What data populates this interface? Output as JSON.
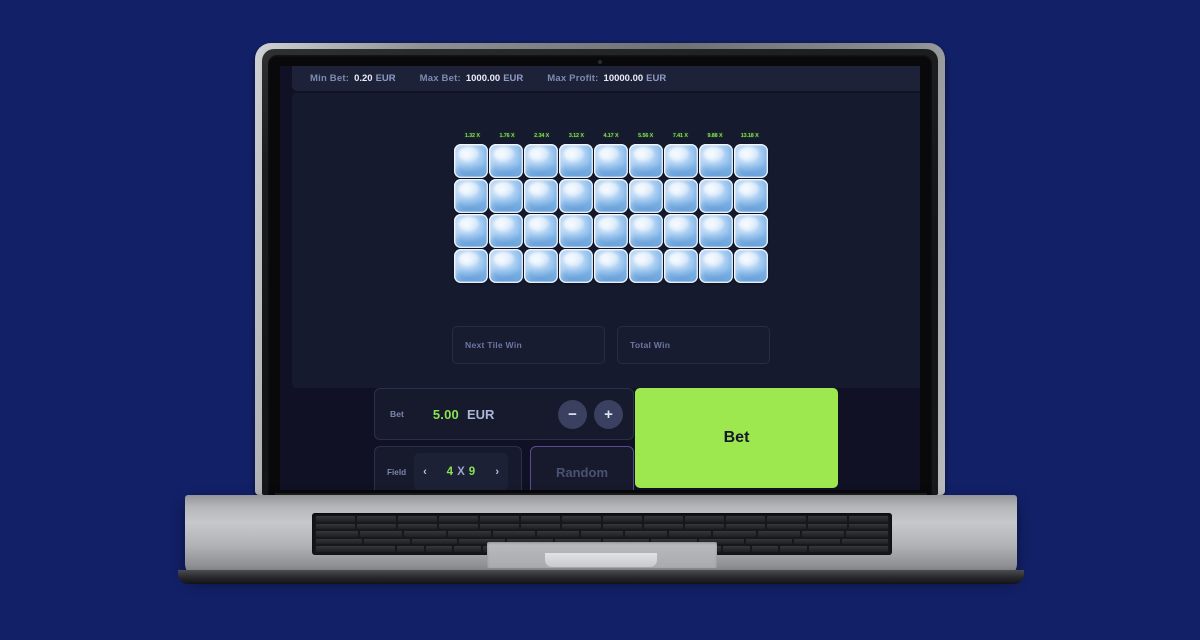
{
  "background_color": "#122068",
  "device": {
    "name": "laptop",
    "brand_accent": "#b7b9bb"
  },
  "topbar": {
    "items": [
      {
        "label": "Min Bet:",
        "value": "0.20",
        "currency": "EUR"
      },
      {
        "label": "Max Bet:",
        "value": "1000.00",
        "currency": "EUR"
      },
      {
        "label": "Max Profit:",
        "value": "10000.00",
        "currency": "EUR"
      }
    ]
  },
  "game": {
    "tile_icon": "ice-cube-icon",
    "multipliers": [
      "1.32 X",
      "1.76 X",
      "2.34 X",
      "3.12 X",
      "4.17 X",
      "5.56 X",
      "7.41 X",
      "9.88 X",
      "13.18 X"
    ],
    "grid": {
      "rows": 4,
      "cols": 9,
      "total_tiles": 36,
      "state": "unrevealed"
    },
    "readouts": [
      {
        "label": "Next Tile Win",
        "value": ""
      },
      {
        "label": "Total Win",
        "value": ""
      }
    ]
  },
  "controls": {
    "bet": {
      "label": "Bet",
      "amount": "5.00",
      "currency": "EUR",
      "decrease_label": "−",
      "increase_label": "+"
    },
    "field": {
      "label": "Field",
      "prev_label": "‹",
      "next_label": "›",
      "rows": "4",
      "separator": "X",
      "cols": "9"
    },
    "random_label": "Random",
    "bet_button_label": "Bet"
  },
  "colors": {
    "accent_green": "#9ee84f",
    "value_green": "#8ae34f",
    "panel": "#161a2e",
    "screen_bg": "#101124",
    "topbar_bg": "#1e2238",
    "random_border": "#5a4a91",
    "ice_light": "#f0f7ff",
    "ice_dark": "#7db4e8"
  }
}
